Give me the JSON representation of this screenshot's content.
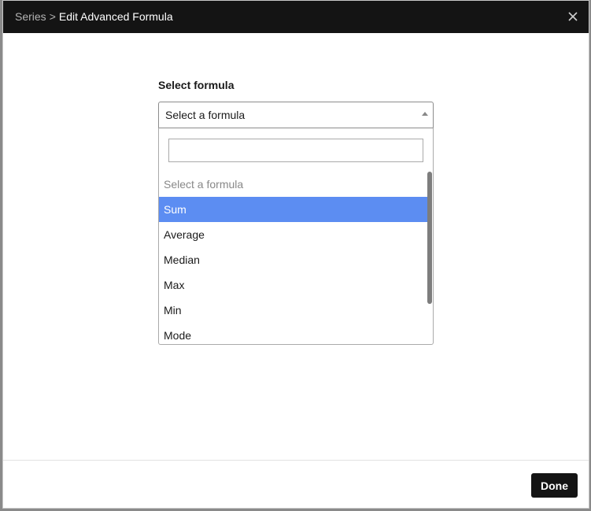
{
  "header": {
    "breadcrumb_parent": "Series",
    "breadcrumb_separator": ">",
    "title": "Edit Advanced Formula",
    "close_icon": "close-icon"
  },
  "form": {
    "label": "Select formula",
    "selected_value": "Select a formula",
    "search_value": "",
    "search_placeholder": "",
    "options": [
      {
        "label": "Select a formula",
        "state": "placeholder"
      },
      {
        "label": "Sum",
        "state": "highlighted"
      },
      {
        "label": "Average",
        "state": "normal"
      },
      {
        "label": "Median",
        "state": "normal"
      },
      {
        "label": "Max",
        "state": "normal"
      },
      {
        "label": "Min",
        "state": "normal"
      },
      {
        "label": "Mode",
        "state": "normal"
      }
    ]
  },
  "footer": {
    "done_label": "Done"
  },
  "colors": {
    "header_bg": "#141414",
    "highlight": "#5c8df2",
    "button_bg": "#141414"
  }
}
